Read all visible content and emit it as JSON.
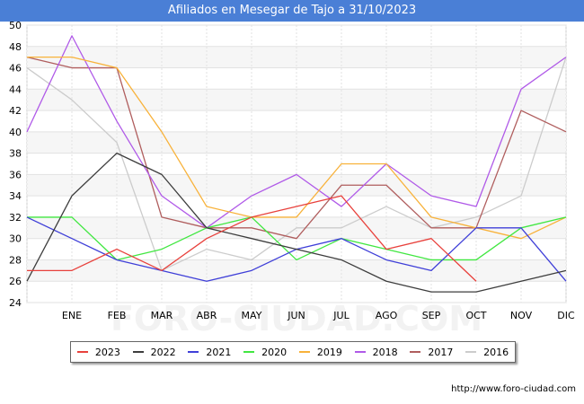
{
  "title": "Afiliados en Mesegar de Tajo a 31/10/2023",
  "source": "http://www.foro-ciudad.com",
  "watermark": "FORO-CIUDAD.COM",
  "chart_data": {
    "type": "line",
    "title": "Afiliados en Mesegar de Tajo a 31/10/2023",
    "x": [
      "",
      "ENE",
      "FEB",
      "MAR",
      "ABR",
      "MAY",
      "JUN",
      "JUL",
      "AGO",
      "SEP",
      "OCT",
      "NOV",
      "DIC"
    ],
    "ylim": [
      24,
      50
    ],
    "yticks": [
      24,
      26,
      28,
      30,
      32,
      34,
      36,
      38,
      40,
      42,
      44,
      46,
      48,
      50
    ],
    "grid": true,
    "legend_position": "bottom",
    "series": [
      {
        "name": "2023",
        "color": "#e8413c",
        "values": [
          27,
          27,
          29,
          27,
          30,
          32,
          33,
          34,
          29,
          30,
          26,
          null,
          null
        ]
      },
      {
        "name": "2022",
        "color": "#3d3d3d",
        "values": [
          26,
          34,
          38,
          36,
          31,
          30,
          29,
          28,
          26,
          25,
          25,
          26,
          27
        ]
      },
      {
        "name": "2021",
        "color": "#3f3fd8",
        "values": [
          32,
          30,
          28,
          27,
          26,
          27,
          29,
          30,
          28,
          27,
          31,
          31,
          26
        ]
      },
      {
        "name": "2020",
        "color": "#41e741",
        "values": [
          32,
          32,
          28,
          29,
          31,
          32,
          28,
          30,
          29,
          28,
          28,
          31,
          32
        ]
      },
      {
        "name": "2019",
        "color": "#f8b23a",
        "values": [
          47,
          47,
          46,
          40,
          33,
          32,
          32,
          37,
          37,
          32,
          31,
          30,
          32
        ]
      },
      {
        "name": "2018",
        "color": "#b05ae8",
        "values": [
          40,
          49,
          41,
          34,
          31,
          34,
          36,
          33,
          37,
          34,
          33,
          44,
          47
        ]
      },
      {
        "name": "2017",
        "color": "#b05e5e",
        "values": [
          47,
          46,
          46,
          32,
          31,
          31,
          30,
          35,
          35,
          31,
          31,
          42,
          40
        ]
      },
      {
        "name": "2016",
        "color": "#cccccc",
        "values": [
          46,
          43,
          39,
          27,
          29,
          28,
          31,
          31,
          33,
          31,
          32,
          34,
          47
        ]
      }
    ]
  }
}
